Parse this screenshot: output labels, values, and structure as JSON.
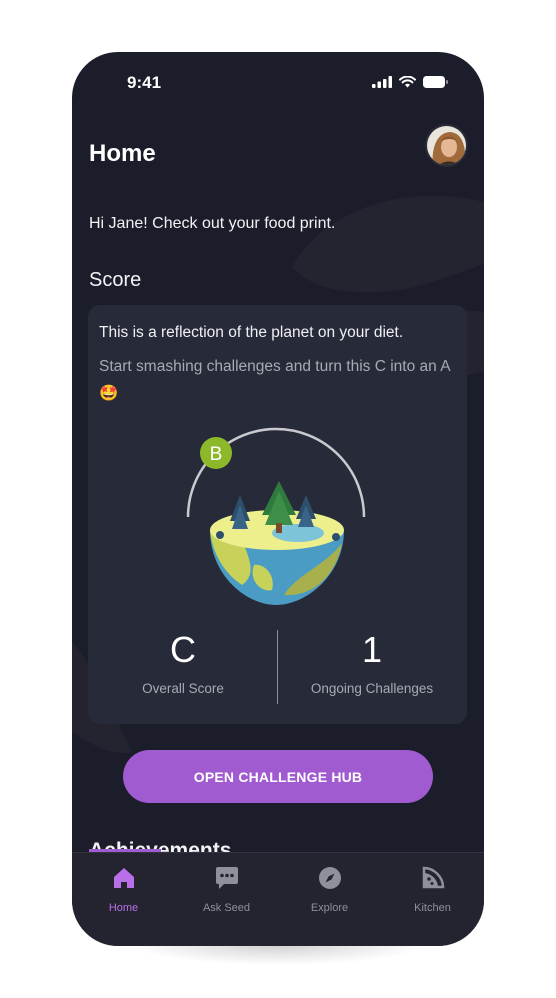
{
  "status_bar": {
    "time": "9:41"
  },
  "header": {
    "title": "Home"
  },
  "greeting": "Hi Jane! Check out your food print.",
  "score_section": {
    "title": "Score",
    "card": {
      "line1": "This is a reflection of the planet on your diet.",
      "line2": "Start smashing challenges and turn this C into an A 🤩",
      "globe_badge": "B",
      "stats": [
        {
          "value": "C",
          "label": "Overall Score"
        },
        {
          "value": "1",
          "label": "Ongoing Challenges"
        }
      ]
    }
  },
  "cta": {
    "label": "OPEN CHALLENGE HUB"
  },
  "achievements": {
    "title": "Achievements"
  },
  "tab_bar": {
    "items": [
      {
        "label": "Home",
        "icon": "home-icon",
        "active": true
      },
      {
        "label": "Ask Seed",
        "icon": "chat-icon",
        "active": false
      },
      {
        "label": "Explore",
        "icon": "compass-icon",
        "active": false
      },
      {
        "label": "Kitchen",
        "icon": "pizza-icon",
        "active": false
      }
    ]
  },
  "colors": {
    "background": "#1c1d2a",
    "card": "#272a38",
    "accent": "#a15bd0",
    "badge": "#8cb82a"
  }
}
